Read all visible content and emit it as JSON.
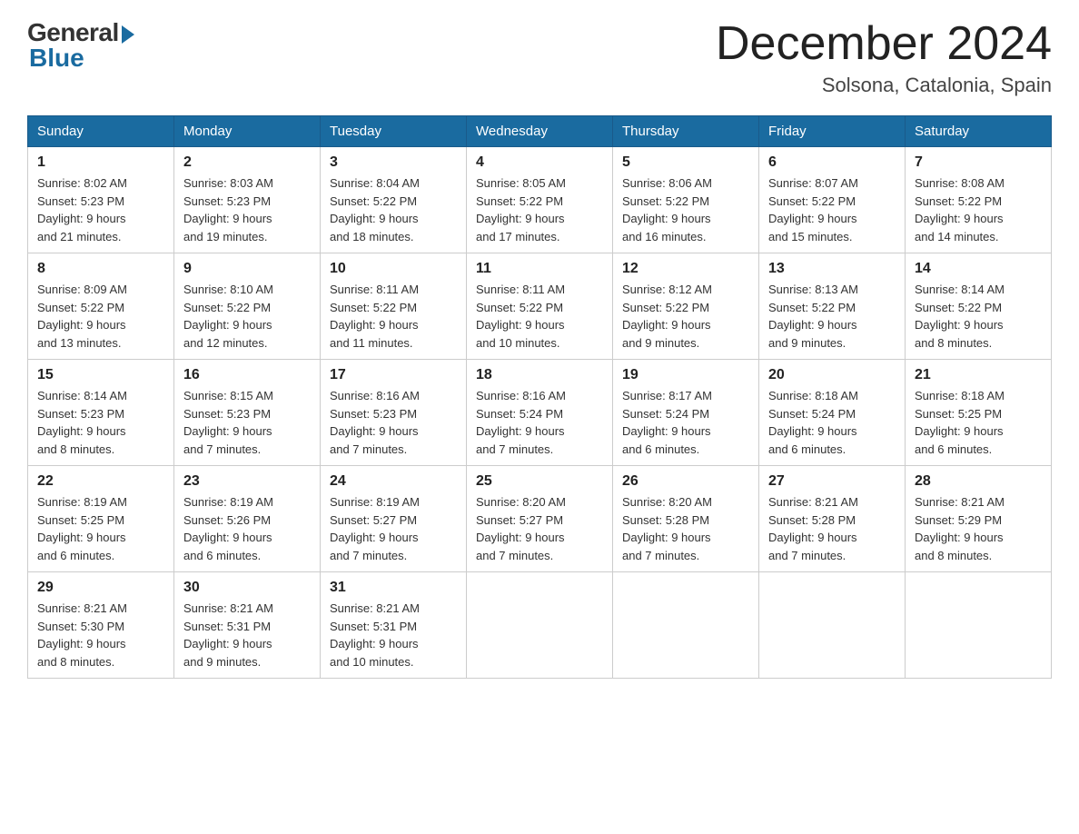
{
  "logo": {
    "general": "General",
    "blue": "Blue"
  },
  "title": {
    "month": "December 2024",
    "location": "Solsona, Catalonia, Spain"
  },
  "weekdays": [
    "Sunday",
    "Monday",
    "Tuesday",
    "Wednesday",
    "Thursday",
    "Friday",
    "Saturday"
  ],
  "weeks": [
    [
      {
        "day": "1",
        "sunrise": "8:02 AM",
        "sunset": "5:23 PM",
        "daylight": "9 hours and 21 minutes."
      },
      {
        "day": "2",
        "sunrise": "8:03 AM",
        "sunset": "5:23 PM",
        "daylight": "9 hours and 19 minutes."
      },
      {
        "day": "3",
        "sunrise": "8:04 AM",
        "sunset": "5:22 PM",
        "daylight": "9 hours and 18 minutes."
      },
      {
        "day": "4",
        "sunrise": "8:05 AM",
        "sunset": "5:22 PM",
        "daylight": "9 hours and 17 minutes."
      },
      {
        "day": "5",
        "sunrise": "8:06 AM",
        "sunset": "5:22 PM",
        "daylight": "9 hours and 16 minutes."
      },
      {
        "day": "6",
        "sunrise": "8:07 AM",
        "sunset": "5:22 PM",
        "daylight": "9 hours and 15 minutes."
      },
      {
        "day": "7",
        "sunrise": "8:08 AM",
        "sunset": "5:22 PM",
        "daylight": "9 hours and 14 minutes."
      }
    ],
    [
      {
        "day": "8",
        "sunrise": "8:09 AM",
        "sunset": "5:22 PM",
        "daylight": "9 hours and 13 minutes."
      },
      {
        "day": "9",
        "sunrise": "8:10 AM",
        "sunset": "5:22 PM",
        "daylight": "9 hours and 12 minutes."
      },
      {
        "day": "10",
        "sunrise": "8:11 AM",
        "sunset": "5:22 PM",
        "daylight": "9 hours and 11 minutes."
      },
      {
        "day": "11",
        "sunrise": "8:11 AM",
        "sunset": "5:22 PM",
        "daylight": "9 hours and 10 minutes."
      },
      {
        "day": "12",
        "sunrise": "8:12 AM",
        "sunset": "5:22 PM",
        "daylight": "9 hours and 9 minutes."
      },
      {
        "day": "13",
        "sunrise": "8:13 AM",
        "sunset": "5:22 PM",
        "daylight": "9 hours and 9 minutes."
      },
      {
        "day": "14",
        "sunrise": "8:14 AM",
        "sunset": "5:22 PM",
        "daylight": "9 hours and 8 minutes."
      }
    ],
    [
      {
        "day": "15",
        "sunrise": "8:14 AM",
        "sunset": "5:23 PM",
        "daylight": "9 hours and 8 minutes."
      },
      {
        "day": "16",
        "sunrise": "8:15 AM",
        "sunset": "5:23 PM",
        "daylight": "9 hours and 7 minutes."
      },
      {
        "day": "17",
        "sunrise": "8:16 AM",
        "sunset": "5:23 PM",
        "daylight": "9 hours and 7 minutes."
      },
      {
        "day": "18",
        "sunrise": "8:16 AM",
        "sunset": "5:24 PM",
        "daylight": "9 hours and 7 minutes."
      },
      {
        "day": "19",
        "sunrise": "8:17 AM",
        "sunset": "5:24 PM",
        "daylight": "9 hours and 6 minutes."
      },
      {
        "day": "20",
        "sunrise": "8:18 AM",
        "sunset": "5:24 PM",
        "daylight": "9 hours and 6 minutes."
      },
      {
        "day": "21",
        "sunrise": "8:18 AM",
        "sunset": "5:25 PM",
        "daylight": "9 hours and 6 minutes."
      }
    ],
    [
      {
        "day": "22",
        "sunrise": "8:19 AM",
        "sunset": "5:25 PM",
        "daylight": "9 hours and 6 minutes."
      },
      {
        "day": "23",
        "sunrise": "8:19 AM",
        "sunset": "5:26 PM",
        "daylight": "9 hours and 6 minutes."
      },
      {
        "day": "24",
        "sunrise": "8:19 AM",
        "sunset": "5:27 PM",
        "daylight": "9 hours and 7 minutes."
      },
      {
        "day": "25",
        "sunrise": "8:20 AM",
        "sunset": "5:27 PM",
        "daylight": "9 hours and 7 minutes."
      },
      {
        "day": "26",
        "sunrise": "8:20 AM",
        "sunset": "5:28 PM",
        "daylight": "9 hours and 7 minutes."
      },
      {
        "day": "27",
        "sunrise": "8:21 AM",
        "sunset": "5:28 PM",
        "daylight": "9 hours and 7 minutes."
      },
      {
        "day": "28",
        "sunrise": "8:21 AM",
        "sunset": "5:29 PM",
        "daylight": "9 hours and 8 minutes."
      }
    ],
    [
      {
        "day": "29",
        "sunrise": "8:21 AM",
        "sunset": "5:30 PM",
        "daylight": "9 hours and 8 minutes."
      },
      {
        "day": "30",
        "sunrise": "8:21 AM",
        "sunset": "5:31 PM",
        "daylight": "9 hours and 9 minutes."
      },
      {
        "day": "31",
        "sunrise": "8:21 AM",
        "sunset": "5:31 PM",
        "daylight": "9 hours and 10 minutes."
      },
      null,
      null,
      null,
      null
    ]
  ],
  "labels": {
    "sunrise": "Sunrise:",
    "sunset": "Sunset:",
    "daylight": "Daylight:"
  }
}
